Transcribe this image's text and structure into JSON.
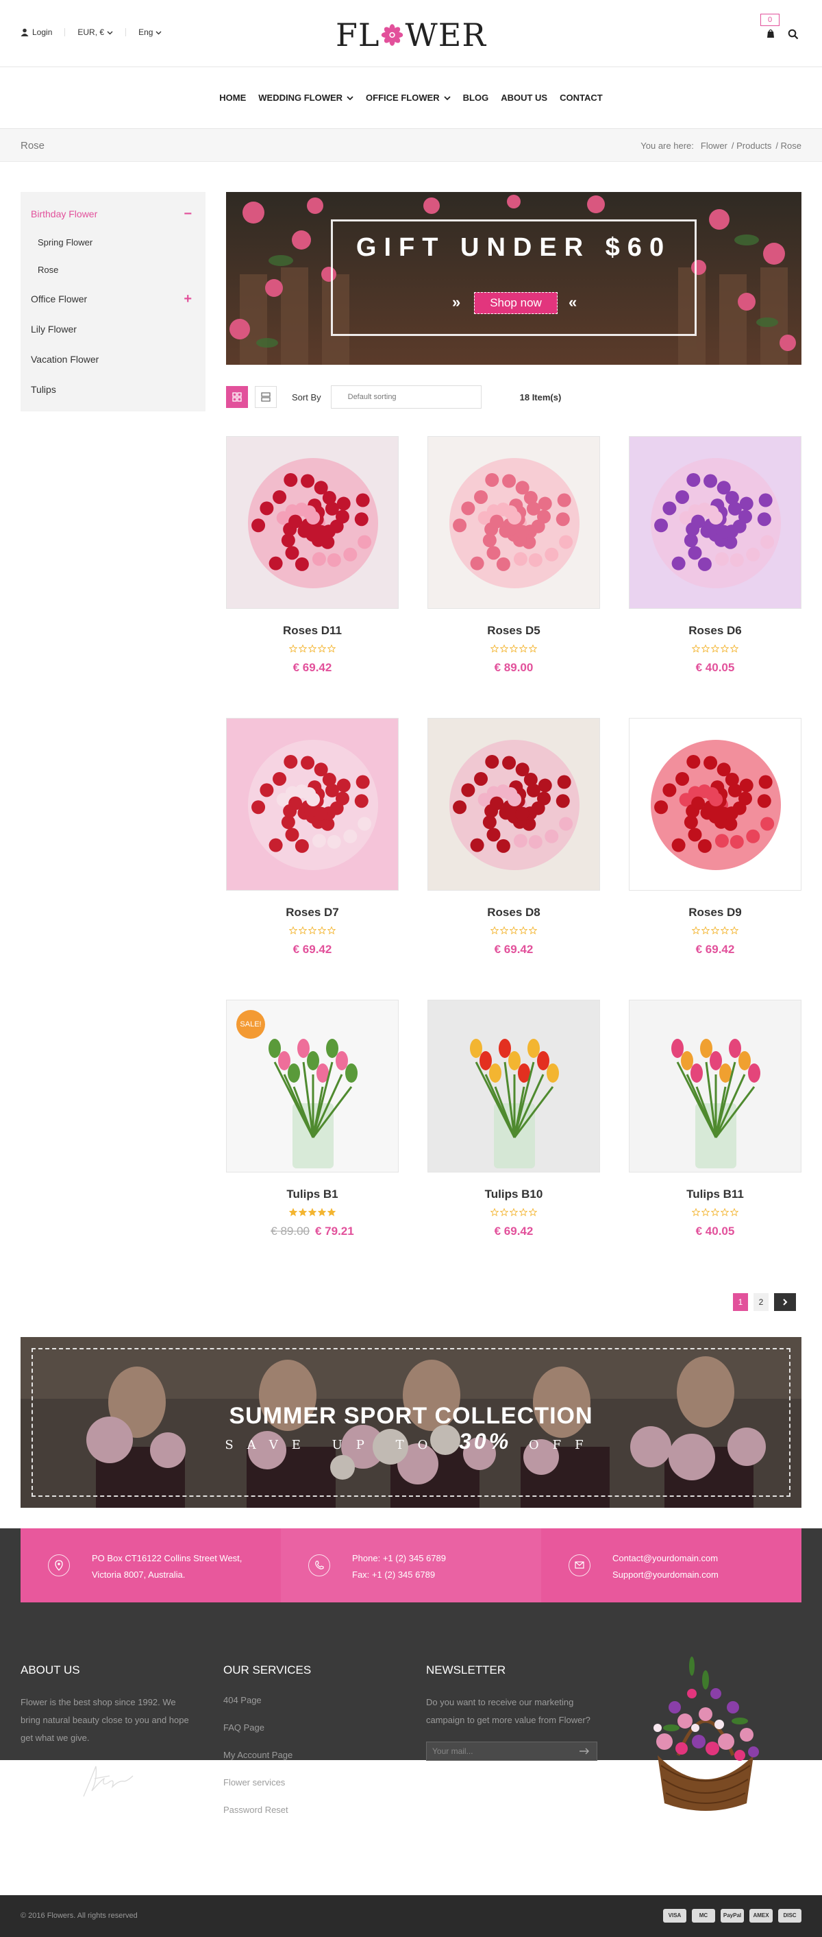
{
  "topbar": {
    "login": "Login",
    "currency": "EUR, €",
    "language": "Eng",
    "cart_count": "0"
  },
  "logo": {
    "left": "FL",
    "right": "WER"
  },
  "nav": [
    "HOME",
    "WEDDING FLOWER",
    "OFFICE FLOWER",
    "BLOG",
    "ABOUT US",
    "CONTACT"
  ],
  "breadcrumb": {
    "title": "Rose",
    "prefix": "You are here:",
    "items": [
      "Flower",
      "/ Products",
      "/ Rose"
    ]
  },
  "sidebar": {
    "items": [
      {
        "label": "Birthday Flower",
        "toggle": "−"
      },
      {
        "label": "Spring Flower"
      },
      {
        "label": "Rose"
      },
      {
        "label": "Office Flower",
        "toggle": "+"
      },
      {
        "label": "Lily Flower"
      },
      {
        "label": "Vacation Flower"
      },
      {
        "label": "Tulips"
      }
    ]
  },
  "banner": {
    "title": "GIFT UNDER $60",
    "button": "Shop now",
    "arrow_left": "»",
    "arrow_right": "«"
  },
  "toolbar": {
    "sort_label": "Sort By",
    "sort_value": "Default sorting",
    "count": "18 Item(s)"
  },
  "products": [
    {
      "name": "Roses D11",
      "price": "€ 69.42",
      "rating": 0
    },
    {
      "name": "Roses D5",
      "price": "€ 89.00",
      "rating": 0
    },
    {
      "name": "Roses D6",
      "price": "€ 40.05",
      "rating": 0
    },
    {
      "name": "Roses D7",
      "price": "€ 69.42",
      "rating": 0
    },
    {
      "name": "Roses D8",
      "price": "€ 69.42",
      "rating": 0
    },
    {
      "name": "Roses D9",
      "price": "€ 69.42",
      "rating": 0
    },
    {
      "name": "Tulips B1",
      "price": "€ 79.21",
      "old_price": "€ 89.00",
      "rating": 5,
      "badge": "SALE!"
    },
    {
      "name": "Tulips B10",
      "price": "€ 69.42",
      "rating": 0
    },
    {
      "name": "Tulips B11",
      "price": "€ 40.05",
      "rating": 0
    }
  ],
  "pagination": {
    "pages": [
      "1",
      "2"
    ],
    "current": "1",
    "next": "›"
  },
  "promo": {
    "title": "SUMMER SPORT COLLECTION",
    "line_pre": "SAVE UP TO",
    "percent": "30%",
    "line_post": "OFF"
  },
  "contact": [
    {
      "line1": "PO Box CT16122 Collins Street West,",
      "line2": "Victoria 8007, Australia."
    },
    {
      "line1": "Phone: +1 (2) 345 6789",
      "line2": "Fax: +1 (2) 345 6789"
    },
    {
      "line1": "Contact@yourdomain.com",
      "line2": "Support@yourdomain.com"
    }
  ],
  "footer": {
    "about": {
      "title": "ABOUT US",
      "text": "Flower is the best shop since 1992. We bring natural beauty close to you and hope get what we give."
    },
    "services": {
      "title": "OUR SERVICES",
      "links": [
        "404 Page",
        "FAQ Page",
        "My Account Page",
        "Flower services",
        "Password Reset"
      ]
    },
    "newsletter": {
      "title": "NEWSLETTER",
      "text": "Do you want to receive our marketing campaign to get more value from Flower?",
      "placeholder": "Your mail..."
    }
  },
  "copyright": "© 2016 Flowers. All rights reserved",
  "payments": [
    "VISA",
    "MC",
    "PayPal",
    "AMEX",
    "DISC"
  ],
  "colors": {
    "accent": "#e2519b",
    "dark": "#3a3a3a",
    "contact_bg": "#e8589c"
  }
}
